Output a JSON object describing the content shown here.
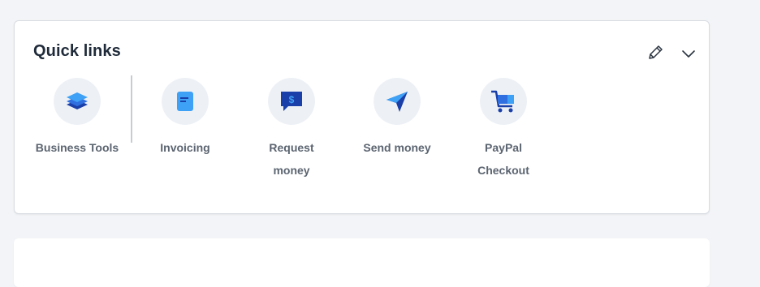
{
  "quick_links": {
    "title": "Quick links",
    "edit_icon": "pencil-icon",
    "collapse_icon": "chevron-down-icon",
    "items": [
      {
        "label": "Business Tools",
        "icon": "layers-icon"
      },
      {
        "label": "Invoicing",
        "icon": "invoice-icon"
      },
      {
        "label": "Request\nmoney",
        "icon": "request-money-icon"
      },
      {
        "label": "Send money",
        "icon": "paper-plane-icon"
      },
      {
        "label": "PayPal\nCheckout",
        "icon": "shopping-cart-icon"
      }
    ]
  },
  "colors": {
    "page_bg": "#f2f4f7",
    "card_bg": "#ffffff",
    "icon_circle_bg": "#edf1f6",
    "brand_dark_blue": "#1b3fa8",
    "brand_light_blue": "#3fa1f5",
    "label_gray": "#5b6470",
    "title_dark": "#1f2b3a"
  }
}
